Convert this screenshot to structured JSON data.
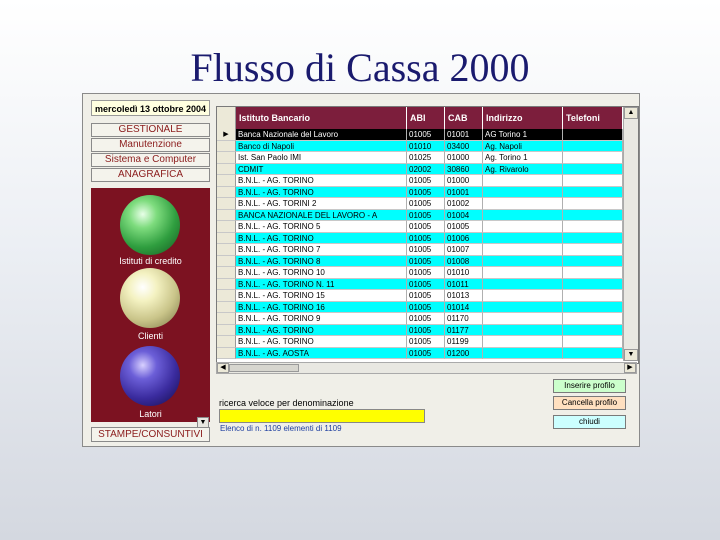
{
  "slide": {
    "title": "Flusso di Cassa 2000"
  },
  "left_panel": {
    "date": "mercoledì 13 ottobre 2004",
    "nav": [
      "GESTIONALE",
      "Manutenzione",
      "Sistema e Computer",
      "ANAGRAFICA"
    ],
    "orbs": [
      {
        "label": "Istituti di credito",
        "icon": "green-orb-icon"
      },
      {
        "label": "Clienti",
        "icon": "yellow-orb-icon"
      },
      {
        "label": "Latori",
        "icon": "purple-orb-icon"
      }
    ],
    "bottom_button": "STAMPE/CONSUNTIVI"
  },
  "grid": {
    "columns": [
      "Istituto Bancario",
      "ABI",
      "CAB",
      "Indirizzo",
      "Telefoni"
    ],
    "rows": [
      [
        "Banca Nazionale del Lavoro",
        "01005",
        "01001",
        "AG Torino 1",
        ""
      ],
      [
        "Banco di Napoli",
        "01010",
        "03400",
        "Ag. Napoli",
        ""
      ],
      [
        "Ist. San Paolo IMI",
        "01025",
        "01000",
        "Ag. Torino 1",
        ""
      ],
      [
        "CDMIT",
        "02002",
        "30860",
        "Ag. Rivarolo",
        ""
      ],
      [
        "B.N.L. - AG. TORINO",
        "01005",
        "01000",
        "",
        ""
      ],
      [
        "B.N.L. - AG. TORINO",
        "01005",
        "01001",
        "",
        ""
      ],
      [
        "B.N.L. - AG. TORINI 2",
        "01005",
        "01002",
        "",
        ""
      ],
      [
        "BANCA NAZIONALE DEL LAVORO - A",
        "01005",
        "01004",
        "",
        ""
      ],
      [
        "B.N.L. - AG. TORINO 5",
        "01005",
        "01005",
        "",
        ""
      ],
      [
        "B.N.L. - AG. TORINO",
        "01005",
        "01006",
        "",
        ""
      ],
      [
        "B.N.L. - AG. TORINO 7",
        "01005",
        "01007",
        "",
        ""
      ],
      [
        "B.N.L. - AG. TORINO 8",
        "01005",
        "01008",
        "",
        ""
      ],
      [
        "B.N.L. - AG. TORINO 10",
        "01005",
        "01010",
        "",
        ""
      ],
      [
        "B.N.L. - AG. TORINO N. 11",
        "01005",
        "01011",
        "",
        ""
      ],
      [
        "B.N.L. - AG. TORINO 15",
        "01005",
        "01013",
        "",
        ""
      ],
      [
        "B.N.L. - AG. TORINO 16",
        "01005",
        "01014",
        "",
        ""
      ],
      [
        "B.N.L. - AG. TORINO 9",
        "01005",
        "01170",
        "",
        ""
      ],
      [
        "B.N.L. - AG. TORINO",
        "01005",
        "01177",
        "",
        ""
      ],
      [
        "B.N.L. - AG. TORINO",
        "01005",
        "01199",
        "",
        ""
      ],
      [
        "B.N.L. - AG. AOSTA",
        "01005",
        "01200",
        "",
        ""
      ]
    ],
    "row_colors": {
      "selected": "#000000",
      "odd": "#00ffff",
      "even": "#ffffff"
    }
  },
  "search": {
    "label": "ricerca veloce per denominazione",
    "value": ""
  },
  "count_text": "Elenco di n.  1109 elementi di  1109",
  "buttons": {
    "insert": "Inserire profilo",
    "delete": "Cancella profilo",
    "close": "chiudi"
  },
  "colors": {
    "header": "#7c1e3c",
    "left_panel": "#7c1221",
    "insert_btn": "#ccffcc",
    "delete_btn": "#ffe0c0",
    "close_btn": "#ccffff",
    "search_bg": "#ffff00"
  }
}
